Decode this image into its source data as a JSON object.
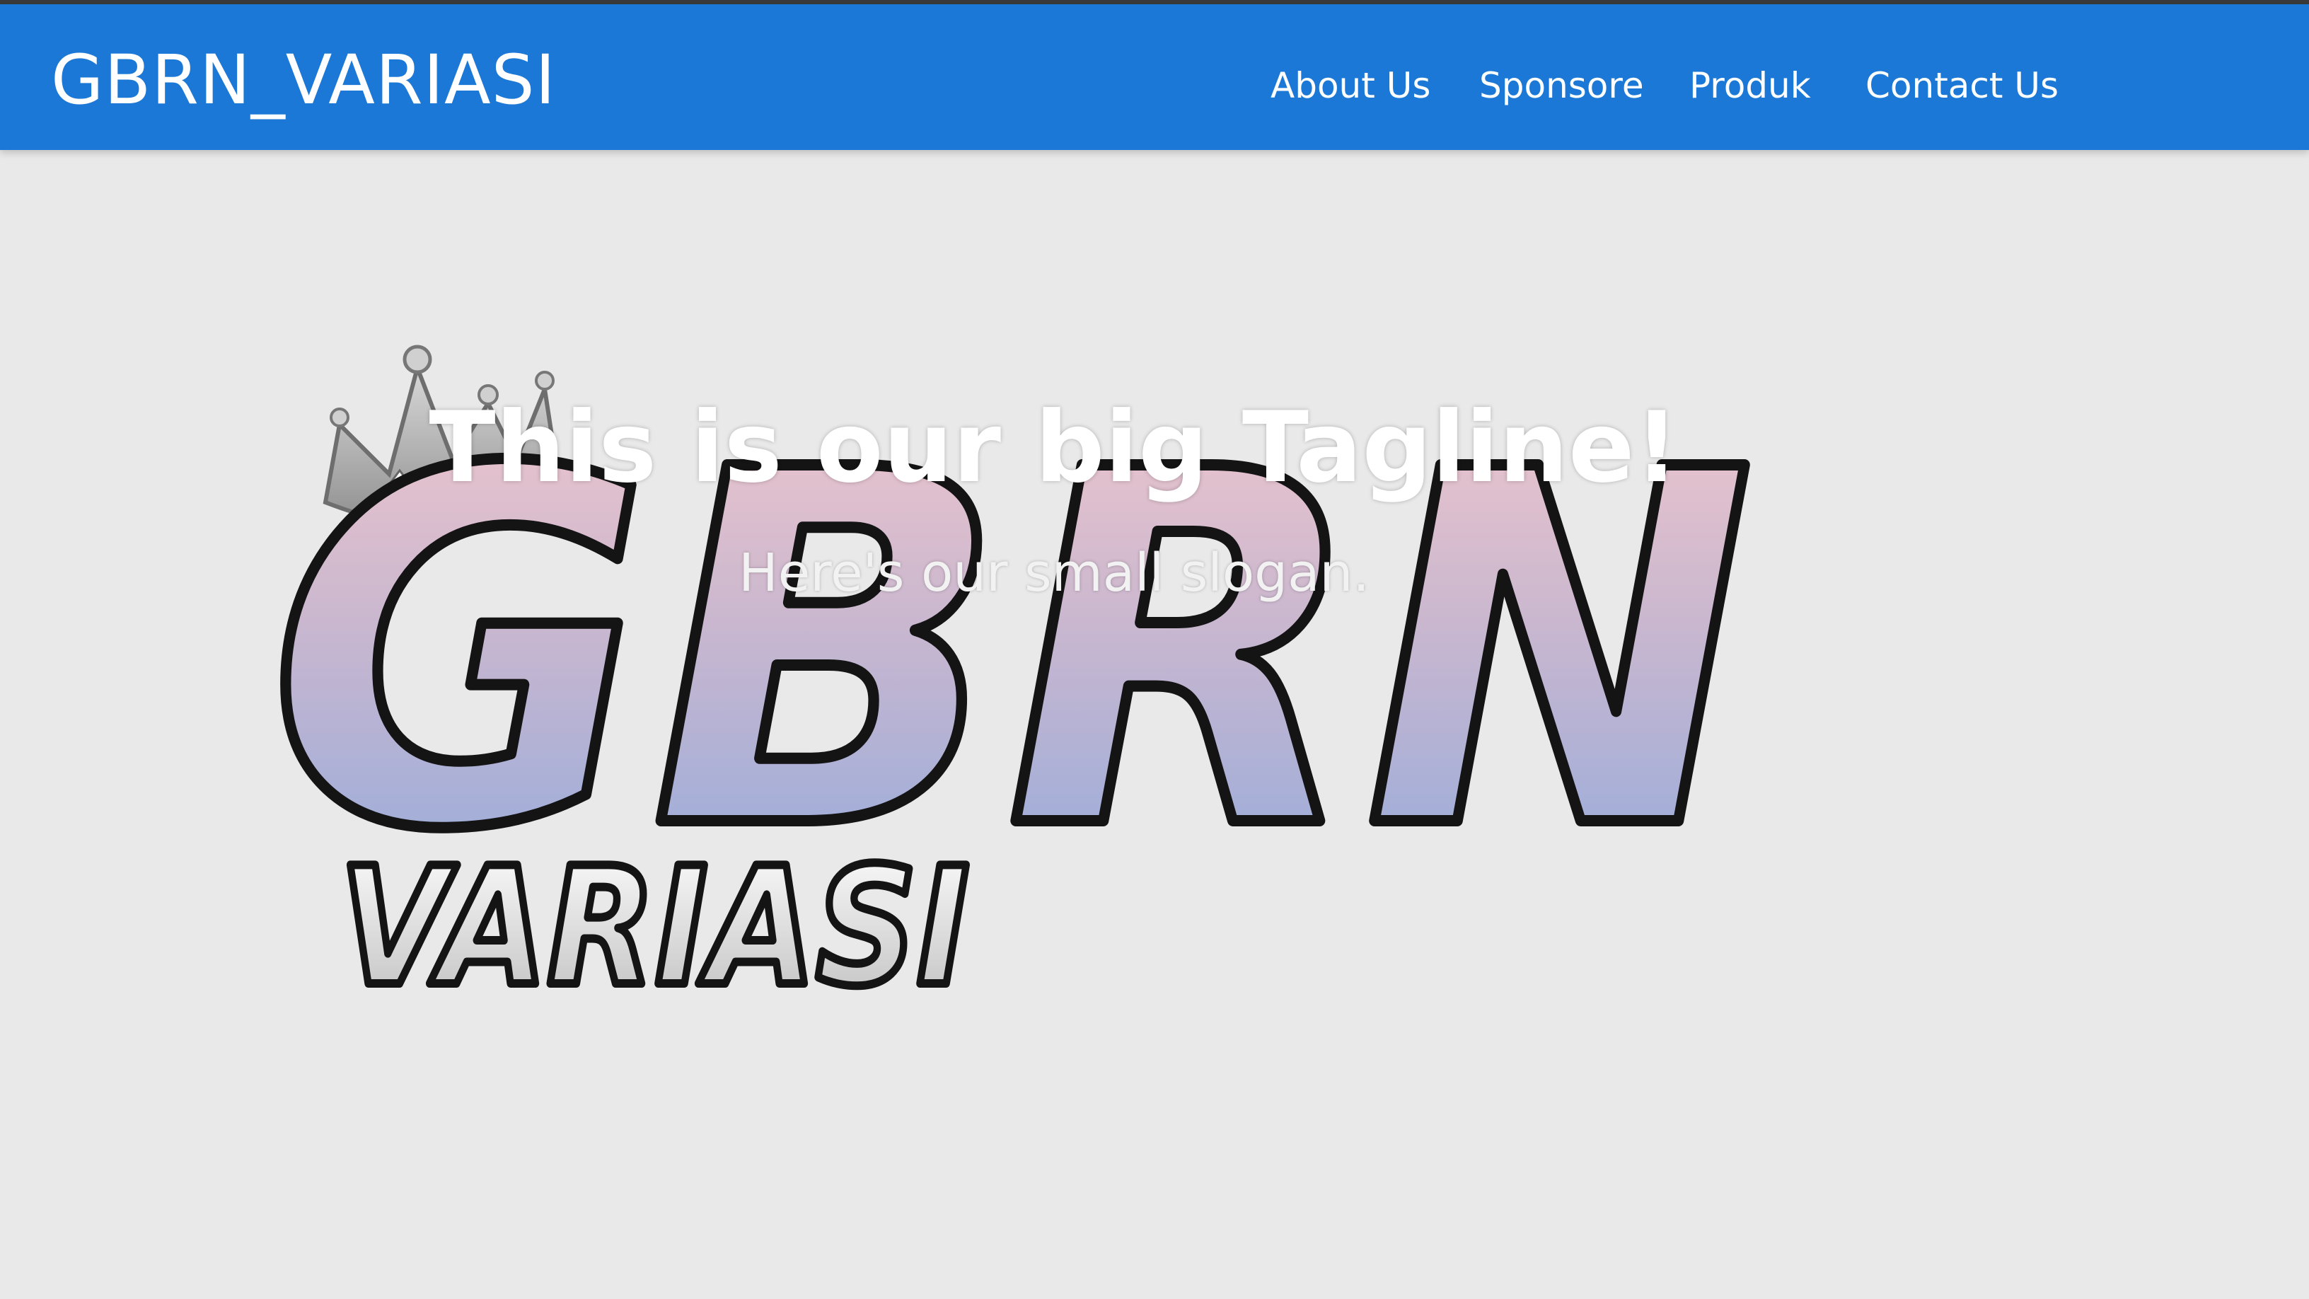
{
  "navbar": {
    "brand": "GBRN_VARIASI",
    "links": [
      "About Us",
      "Sponsore",
      "Produk",
      "Contact Us"
    ],
    "background_color": "#1b78d6"
  },
  "hero": {
    "tagline": "This is our big Tagline!",
    "slogan": "Here's our small slogan.",
    "logo": {
      "main_text": "GBRN",
      "sub_text": "VARIASI",
      "icon": "crown-icon",
      "gradient_top": "#f2c9cf",
      "gradient_bottom": "#92acdd"
    },
    "background_color": "#e9e9e9"
  }
}
